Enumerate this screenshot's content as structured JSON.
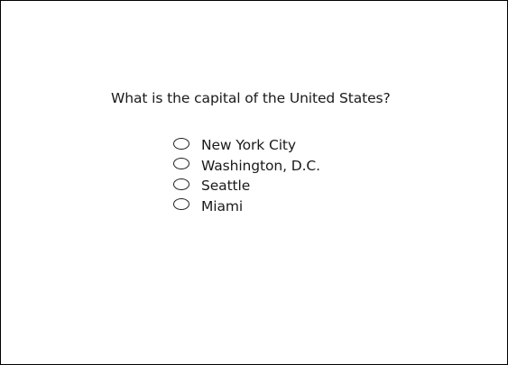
{
  "quiz": {
    "question": "What is the capital of the United States?",
    "options": [
      {
        "label": "New York City",
        "selected": false
      },
      {
        "label": "Washington, D.C.",
        "selected": false
      },
      {
        "label": "Seattle",
        "selected": false
      },
      {
        "label": "Miami",
        "selected": false
      }
    ]
  }
}
